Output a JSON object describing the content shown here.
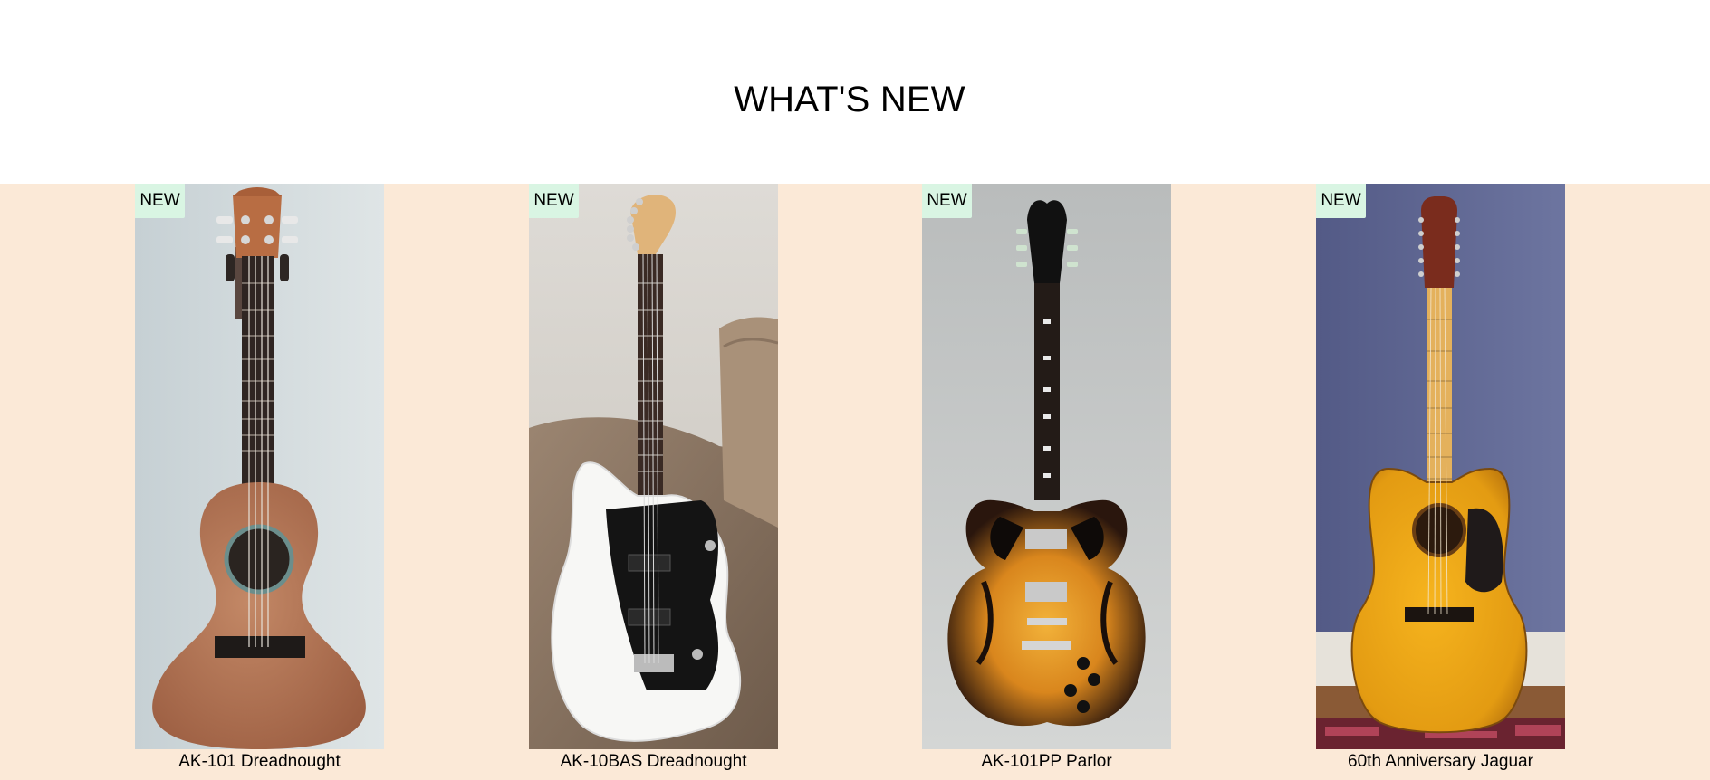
{
  "section": {
    "title": "WHAT'S NEW"
  },
  "colors": {
    "section_background": "#fbe9d7",
    "badge_background": "#d9f5e3"
  },
  "products": [
    {
      "name": "AK-101 Dreadnought",
      "badge": "NEW",
      "image": "ukulele-photo"
    },
    {
      "name": "AK-10BAS Dreadnought",
      "badge": "NEW",
      "image": "white-electric-guitar-photo"
    },
    {
      "name": "AK-101PP Parlor",
      "badge": "NEW",
      "image": "sunburst-semi-hollow-guitar-photo"
    },
    {
      "name": "60th Anniversary Jaguar",
      "badge": "NEW",
      "image": "acoustic-12-string-guitar-photo"
    }
  ]
}
